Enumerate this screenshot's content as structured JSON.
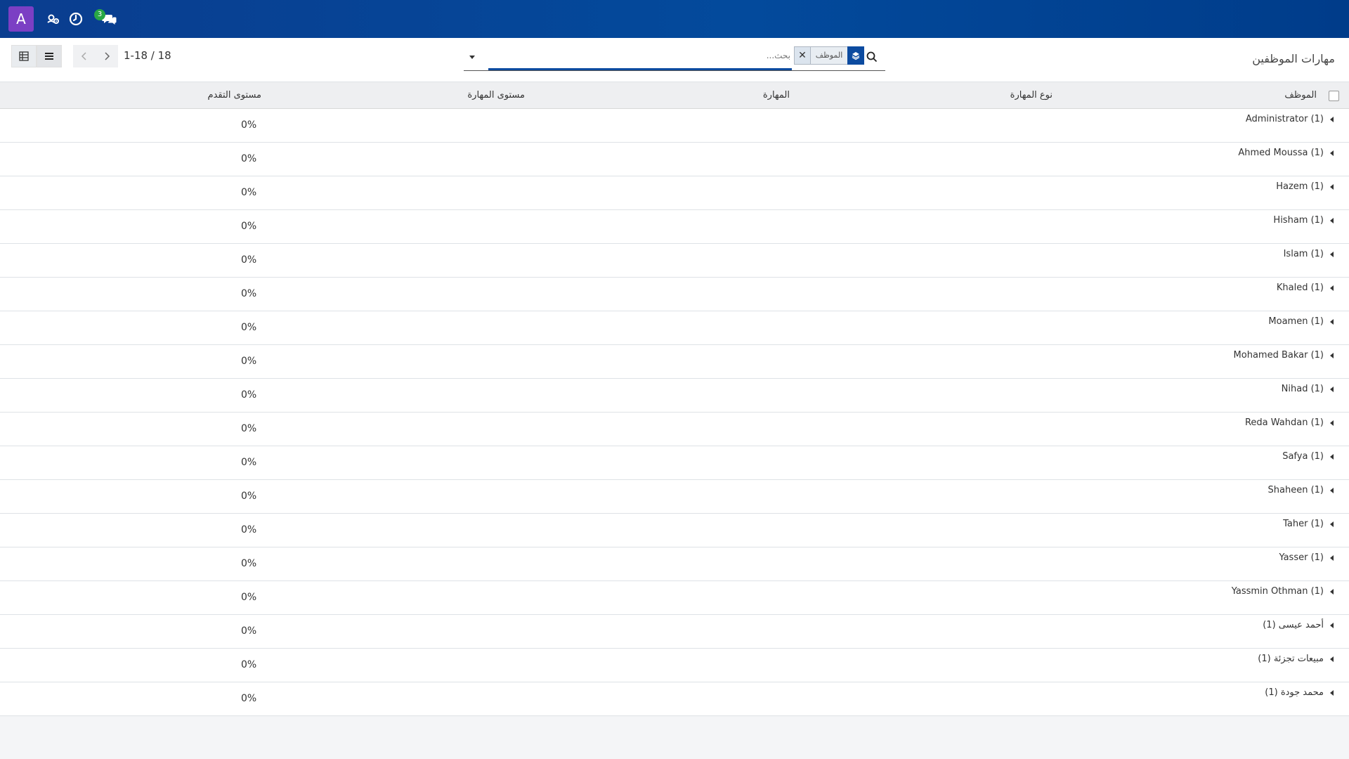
{
  "navbar": {
    "avatar_letter": "A",
    "icons": [
      "users-gear-icon",
      "clock-icon",
      "chat-bubbles-icon"
    ],
    "chat_badge": "3",
    "brand_color": "#034a9c"
  },
  "control_panel": {
    "title": "مهارات الموظفين",
    "pager": "1-18 / 18",
    "views": [
      "pivot-view-icon",
      "list-view-icon"
    ],
    "search": {
      "facet_value": "الموظف",
      "facet_icon": "layers-icon",
      "placeholder": "بحث..."
    }
  },
  "list": {
    "columns": {
      "employee": "الموظف",
      "skill_type": "نوع المهارة",
      "skill": "المهارة",
      "skill_level": "مستوى المهارة",
      "progress": "مستوى التقدم"
    },
    "groups": [
      {
        "name": "Administrator (1)",
        "progress": "0%"
      },
      {
        "name": "Ahmed Moussa (1)",
        "progress": "0%"
      },
      {
        "name": "Hazem (1)",
        "progress": "0%"
      },
      {
        "name": "Hisham (1)",
        "progress": "0%"
      },
      {
        "name": "Islam (1)",
        "progress": "0%"
      },
      {
        "name": "Khaled (1)",
        "progress": "0%"
      },
      {
        "name": "Moamen (1)",
        "progress": "0%"
      },
      {
        "name": "Mohamed Bakar (1)",
        "progress": "0%"
      },
      {
        "name": "Nihad (1)",
        "progress": "0%"
      },
      {
        "name": "Reda Wahdan (1)",
        "progress": "0%"
      },
      {
        "name": "Safya (1)",
        "progress": "0%"
      },
      {
        "name": "Shaheen (1)",
        "progress": "0%"
      },
      {
        "name": "Taher (1)",
        "progress": "0%"
      },
      {
        "name": "Yasser (1)",
        "progress": "0%"
      },
      {
        "name": "Yassmin Othman (1)",
        "progress": "0%"
      },
      {
        "name": "أحمد عيسى (1)",
        "progress": "0%"
      },
      {
        "name": "مبيعات تجزئة (1)",
        "progress": "0%"
      },
      {
        "name": "محمد جودة (1)",
        "progress": "0%"
      }
    ]
  }
}
